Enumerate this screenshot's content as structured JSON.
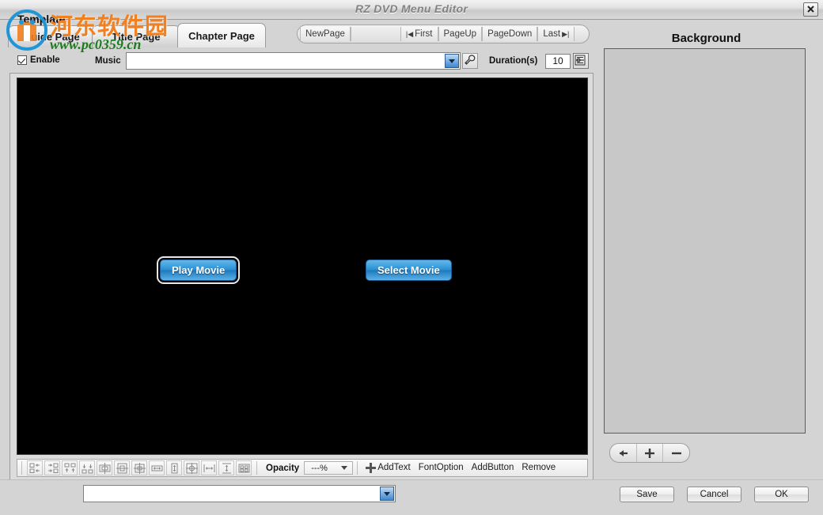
{
  "window": {
    "title": "RZ DVD Menu Editor",
    "close_icon": "close-icon"
  },
  "watermark": {
    "brand_cn": "河东软件园",
    "url": "www.pc0359.cn"
  },
  "tabs": [
    {
      "label": "Guide Page",
      "active": false
    },
    {
      "label": "Title Page",
      "active": false
    },
    {
      "label": "Chapter Page",
      "active": true
    }
  ],
  "nav": {
    "new_page": "NewPage",
    "page_field": "",
    "first": "First",
    "page_up": "PageUp",
    "page_down": "PageDown",
    "last": "Last"
  },
  "music_row": {
    "enable_label": "Enable",
    "enable_checked": true,
    "music_label": "Music",
    "music_value": "",
    "music_tool_icon": "music-settings-icon",
    "duration_label": "Duration(s)",
    "duration_value": "10",
    "duration_tool_icon": "duration-settings-icon"
  },
  "canvas": {
    "background_color": "#000000",
    "buttons": [
      {
        "label": "Play Movie",
        "selected": true
      },
      {
        "label": "Select Movie",
        "selected": false
      }
    ]
  },
  "edit_toolbar": {
    "align_icons": [
      "align-left-icon",
      "align-right-icon",
      "align-top-icon",
      "align-bottom-icon",
      "center-horizontal-icon",
      "center-vertical-icon",
      "center-both-icon",
      "same-width-icon",
      "same-height-icon",
      "same-size-icon",
      "distribute-horizontal-icon",
      "distribute-vertical-icon",
      "grid-icon"
    ],
    "opacity_label": "Opacity",
    "opacity_value": "---%",
    "add_text": "AddText",
    "font_option": "FontOption",
    "add_button": "AddButton",
    "remove": "Remove"
  },
  "background_panel": {
    "title": "Background",
    "items": [],
    "buttons": [
      {
        "icon": "arrow-left-icon",
        "glyph": "←"
      },
      {
        "icon": "plus-icon",
        "glyph": "+"
      },
      {
        "icon": "minus-icon",
        "glyph": "−"
      }
    ]
  },
  "footer": {
    "template_label": "Template",
    "template_value": "",
    "save": "Save",
    "cancel": "Cancel",
    "ok": "OK"
  },
  "colors": {
    "accent_blue": "#2a8fd4",
    "panel_gray": "#d4d4d4",
    "list_gray": "#c8c8c8",
    "canvas_black": "#000000",
    "watermark_orange": "#f08020",
    "watermark_green": "#1d7a1d"
  }
}
